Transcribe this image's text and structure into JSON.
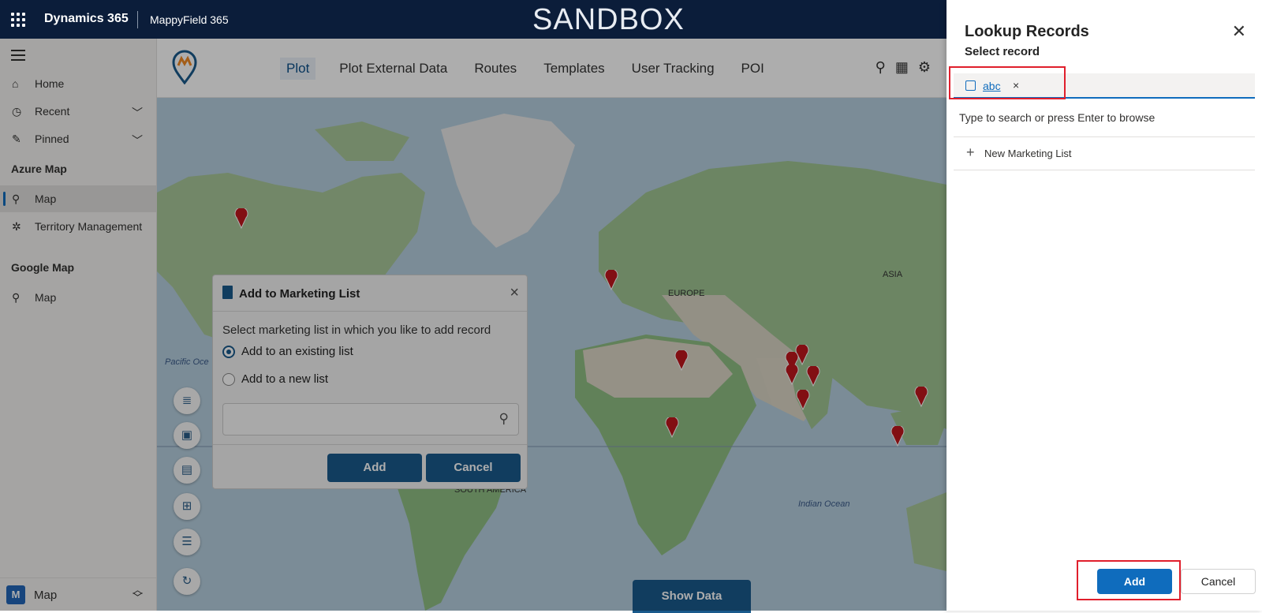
{
  "topbar": {
    "brand": "Dynamics 365",
    "app_name": "MappyField 365",
    "environment_banner": "SANDBOX"
  },
  "sidebar": {
    "items": [
      {
        "label": "Home",
        "icon": "home-icon"
      },
      {
        "label": "Recent",
        "icon": "clock-icon"
      },
      {
        "label": "Pinned",
        "icon": "pin-icon"
      }
    ],
    "groups": [
      {
        "title": "Azure Map",
        "items": [
          {
            "label": "Map",
            "icon": "map-marker-icon",
            "selected": true
          },
          {
            "label": "Territory Management",
            "icon": "territory-icon"
          }
        ]
      },
      {
        "title": "Google Map",
        "items": [
          {
            "label": "Map",
            "icon": "map-marker-icon"
          }
        ]
      }
    ],
    "area": {
      "badge": "M",
      "label": "Map"
    }
  },
  "app_header": {
    "tabs": [
      "Plot",
      "Plot External Data",
      "Routes",
      "Templates",
      "User Tracking",
      "POI"
    ],
    "active_tab": "Plot",
    "icons": [
      "search-icon",
      "calendar-icon",
      "gear-icon"
    ]
  },
  "map": {
    "labels": {
      "europe": "EUROPE",
      "asia": "ASIA",
      "pacific": "Pacific Oce",
      "south_america": "SOUTH AMERICA",
      "indian_ocean": "Indian Ocean"
    },
    "show_data": "Show Data",
    "tools": [
      "list-icon",
      "save-icon",
      "document-icon",
      "grid-icon",
      "numbered-list-icon",
      "refresh-icon"
    ]
  },
  "marketing_dialog": {
    "title": "Add to Marketing List",
    "description": "Select marketing list in which you like to add record",
    "options": [
      "Add to an existing list",
      "Add to a new list"
    ],
    "selected_option": "Add to an existing list",
    "search_value": "",
    "add_label": "Add",
    "cancel_label": "Cancel"
  },
  "lookup_panel": {
    "title": "Lookup Records",
    "subtitle": "Select record",
    "selected_chip": "abc",
    "hint": "Type to search or press Enter to browse",
    "new_item_label": "New Marketing List",
    "add_label": "Add",
    "cancel_label": "Cancel",
    "highlight_color": "#e01f2c",
    "accent_color": "#0f6cbd"
  }
}
